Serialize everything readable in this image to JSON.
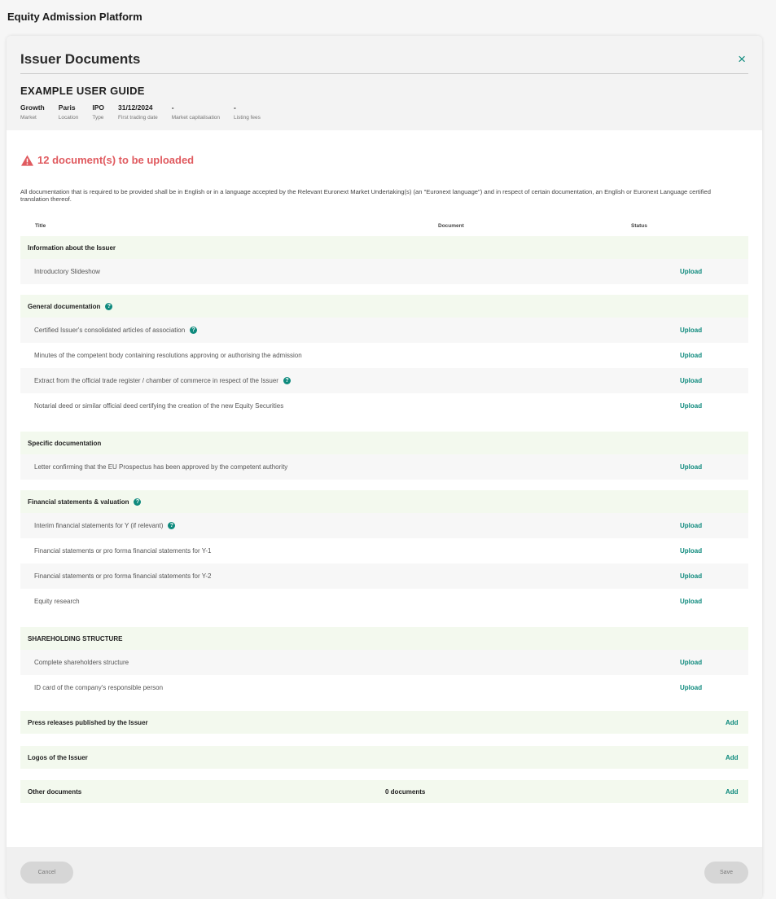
{
  "app": {
    "title": "Equity Admission Platform"
  },
  "modal": {
    "title": "Issuer Documents",
    "close_icon": "×",
    "guide_title": "EXAMPLE USER GUIDE",
    "meta": [
      {
        "value": "Growth",
        "label": "Market"
      },
      {
        "value": "Paris",
        "label": "Location"
      },
      {
        "value": "IPO",
        "label": "Type"
      },
      {
        "value": "31/12/2024",
        "label": "First trading date"
      },
      {
        "value": "-",
        "label": "Market capitalisation"
      },
      {
        "value": "-",
        "label": "Listing fees"
      }
    ]
  },
  "warning": {
    "icon": "warning-triangle-icon",
    "text": "12 document(s) to be uploaded",
    "color": "#e05a5f"
  },
  "intro": "All documentation that is required to be provided shall be in English or in a language accepted by the Relevant Euronext Market Undertaking(s) (an \"Euronext language\") and in respect of certain documentation, an English or Euronext Language certified translation thereof.",
  "columns": {
    "title": "Title",
    "document": "Document",
    "status": "Status"
  },
  "sections": [
    {
      "title": "Information about the Issuer",
      "help": false,
      "items": [
        {
          "label": "Introductory Slideshow",
          "help": false,
          "action": "Upload"
        }
      ]
    },
    {
      "title": "General documentation",
      "help": true,
      "items": [
        {
          "label": "Certified Issuer's consolidated articles of association",
          "help": true,
          "action": "Upload"
        },
        {
          "label": "Minutes of the competent body containing resolutions approving or authorising the admission",
          "help": false,
          "action": "Upload"
        },
        {
          "label": "Extract from the official trade register / chamber of commerce in respect of the Issuer",
          "help": true,
          "action": "Upload"
        },
        {
          "label": "Notarial deed or similar official deed certifying the creation of the new Equity Securities",
          "help": false,
          "action": "Upload"
        }
      ]
    },
    {
      "title": "Specific documentation",
      "help": false,
      "items": [
        {
          "label": "Letter confirming that the EU Prospectus has been approved by the competent authority",
          "help": false,
          "action": "Upload"
        }
      ]
    },
    {
      "title": "Financial statements & valuation",
      "help": true,
      "items": [
        {
          "label": "Interim financial statements for Y (if relevant)",
          "help": true,
          "action": "Upload"
        },
        {
          "label": "Financial statements or pro forma financial statements for Y-1",
          "help": false,
          "action": "Upload"
        },
        {
          "label": "Financial statements or pro forma financial statements for Y-2",
          "help": false,
          "action": "Upload"
        },
        {
          "label": "Equity research",
          "help": false,
          "action": "Upload"
        }
      ]
    },
    {
      "title": "SHAREHOLDING STRUCTURE",
      "help": false,
      "items": [
        {
          "label": "Complete shareholders structure",
          "help": false,
          "action": "Upload"
        },
        {
          "label": "ID card of the company's responsible person",
          "help": false,
          "action": "Upload"
        }
      ]
    }
  ],
  "extra_sections": [
    {
      "title": "Press releases published by the Issuer",
      "count": "",
      "action": "Add"
    },
    {
      "title": "Logos of the Issuer",
      "count": "",
      "action": "Add"
    },
    {
      "title": "Other documents",
      "count": "0 documents",
      "action": "Add"
    }
  ],
  "footer": {
    "cancel_label": "Cancel",
    "save_label": "Save"
  },
  "colors": {
    "accent": "#0e8a7d",
    "section_bg": "#f3f9ee",
    "warning": "#e05a5f"
  }
}
